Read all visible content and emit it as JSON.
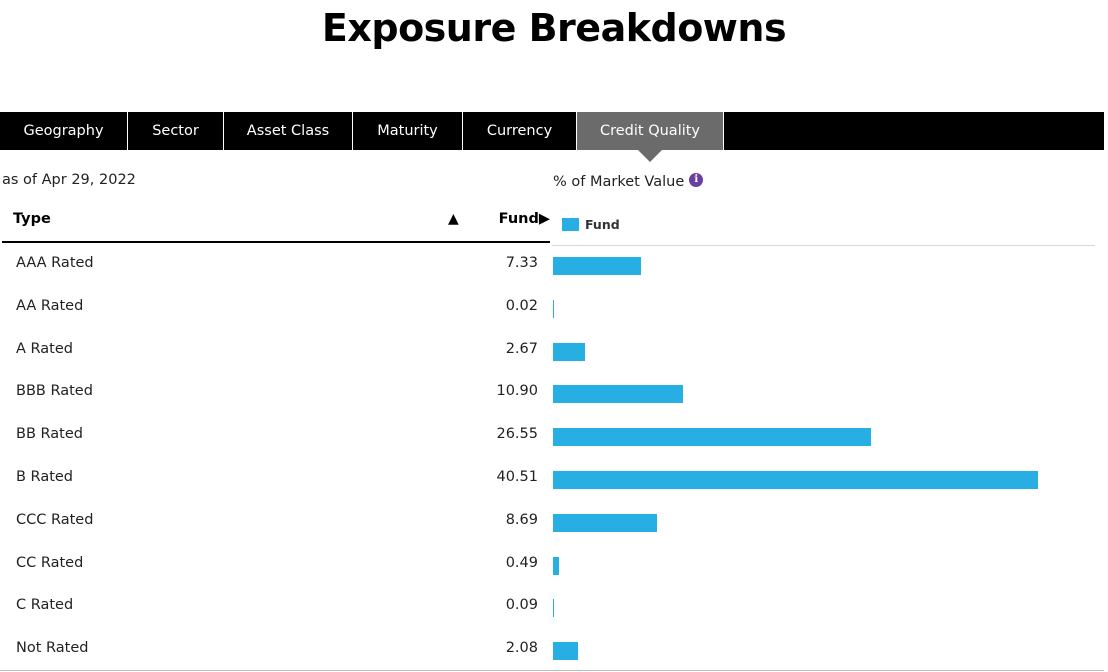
{
  "page_title": "Exposure Breakdowns",
  "tabs": [
    {
      "label": "Geography",
      "active": false
    },
    {
      "label": "Sector",
      "active": false
    },
    {
      "label": "Asset Class",
      "active": false
    },
    {
      "label": "Maturity",
      "active": false
    },
    {
      "label": "Currency",
      "active": false
    },
    {
      "label": "Credit Quality",
      "active": true
    }
  ],
  "as_of": "as of Apr 29, 2022",
  "market_value_label": "% of Market Value",
  "info_icon": "info-icon",
  "table": {
    "col_type": "Type",
    "sort_indicator": "▲",
    "col_fund": "Fund▶"
  },
  "legend_label": "Fund",
  "colors": {
    "bar": "#27aee2",
    "active_tab": "#6b6b6b",
    "tabbar": "#000000"
  },
  "chart_data": {
    "type": "bar",
    "orientation": "horizontal",
    "categories": [
      "AAA Rated",
      "AA Rated",
      "A Rated",
      "BBB Rated",
      "BB Rated",
      "B Rated",
      "CCC Rated",
      "CC Rated",
      "C Rated",
      "Not Rated"
    ],
    "series": [
      {
        "name": "Fund",
        "values": [
          7.33,
          0.02,
          2.67,
          10.9,
          26.55,
          40.51,
          8.69,
          0.49,
          0.09,
          2.08
        ]
      }
    ],
    "value_labels": [
      "7.33",
      "0.02",
      "2.67",
      "10.90",
      "26.55",
      "40.51",
      "8.69",
      "0.49",
      "0.09",
      "2.08"
    ],
    "xlim": [
      0,
      45
    ]
  }
}
